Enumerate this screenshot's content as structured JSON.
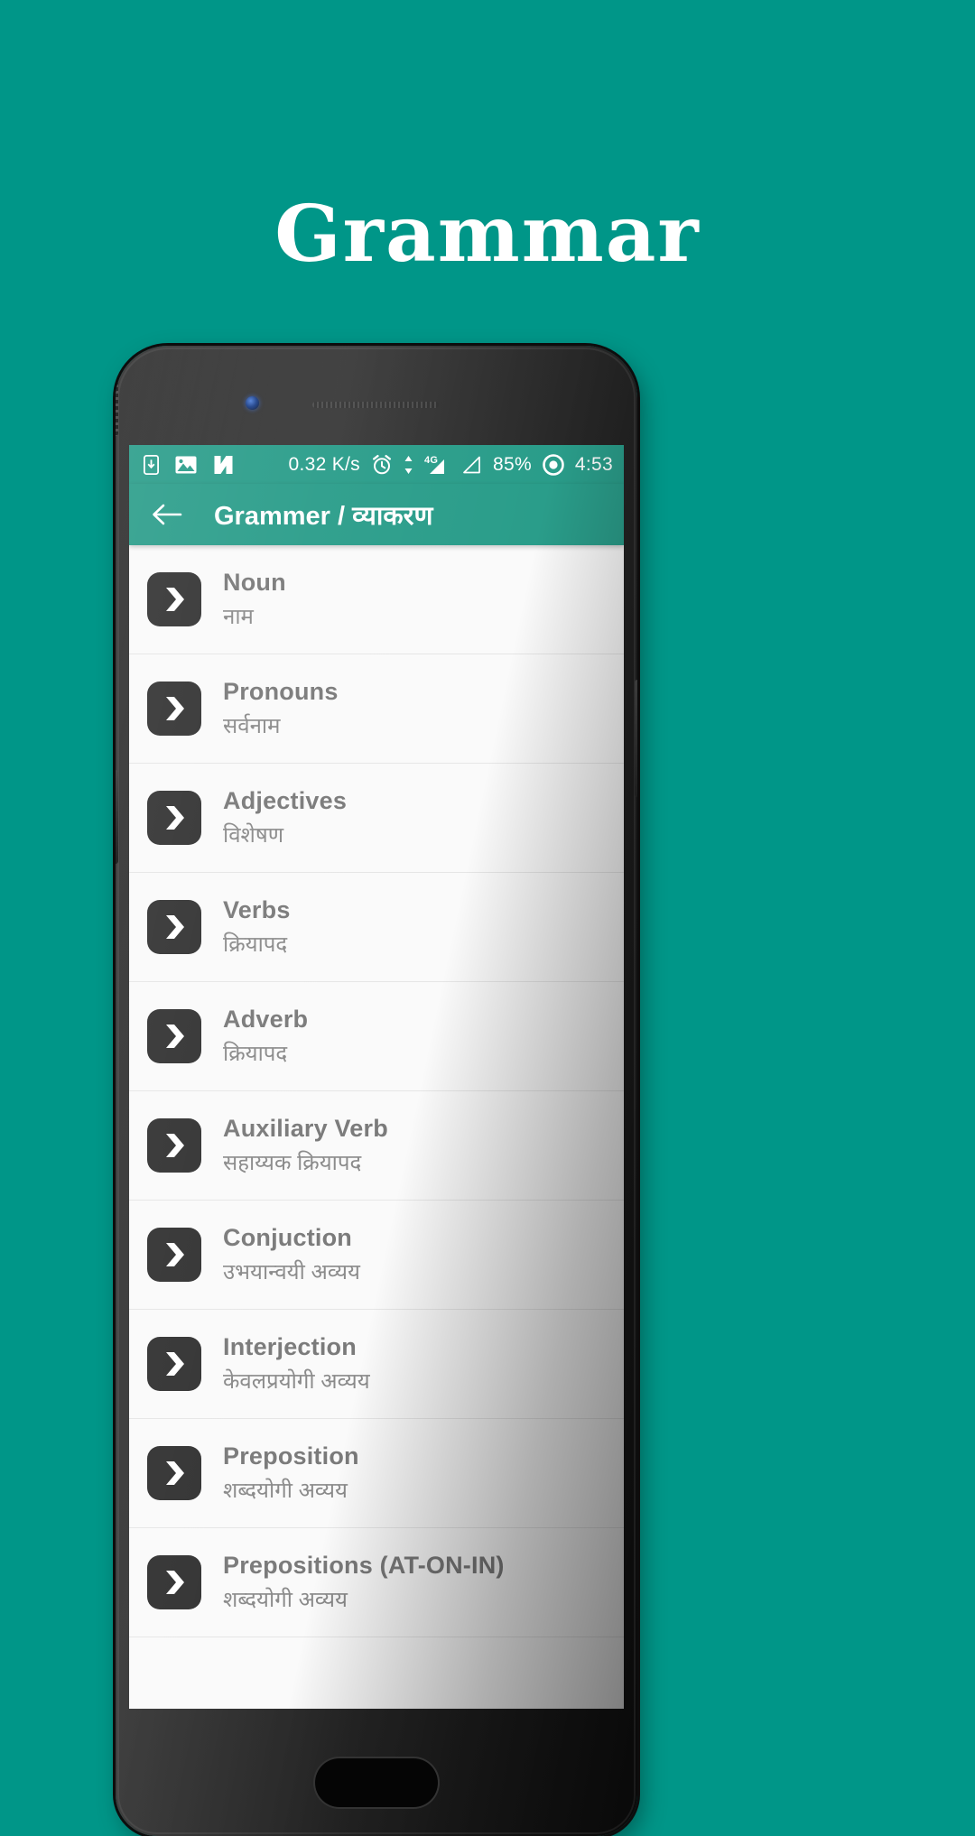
{
  "hero": {
    "title": "Grammar",
    "background_color": "#009688"
  },
  "phone": {
    "frame_color": "#2c2c2c",
    "camera_icon": "front-camera",
    "speaker_icon": "earpiece-speaker",
    "home_button_label": "Home"
  },
  "statusbar": {
    "background_color": "#2a9d8a",
    "left_icons": [
      "sd-card-icon",
      "screenshot-icon",
      "app-notification-icon"
    ],
    "network_speed": "0.32 K/s",
    "alarm_icon": "alarm-clock-icon",
    "data_arrows_icon": "data-transfer-icon",
    "network_type": "4G",
    "signal_icon": "signal-bars-icon",
    "signal2_icon": "signal-bars-2-icon",
    "battery": "85%",
    "dnd_icon": "do-not-disturb-icon",
    "time": "4:53"
  },
  "appbar": {
    "back_icon": "back-arrow-icon",
    "title": "Grammer / व्याकरण",
    "background_color": "#2a9d8a"
  },
  "list": {
    "item_icon": "chevron-right-badge-icon",
    "items": [
      {
        "title": "Noun",
        "subtitle": "नाम"
      },
      {
        "title": "Pronouns",
        "subtitle": "सर्वनाम"
      },
      {
        "title": "Adjectives",
        "subtitle": "विशेषण"
      },
      {
        "title": "Verbs",
        "subtitle": "क्रियापद"
      },
      {
        "title": "Adverb",
        "subtitle": "क्रियापद"
      },
      {
        "title": "Auxiliary Verb",
        "subtitle": "सहाय्यक क्रियापद"
      },
      {
        "title": "Conjuction",
        "subtitle": "उभयान्वयी अव्यय"
      },
      {
        "title": "Interjection",
        "subtitle": "केवलप्रयोगी अव्यय"
      },
      {
        "title": "Preposition",
        "subtitle": "शब्दयोगी अव्यय"
      },
      {
        "title": "Prepositions (AT-ON-IN)",
        "subtitle": "शब्दयोगी अव्यय"
      }
    ]
  }
}
